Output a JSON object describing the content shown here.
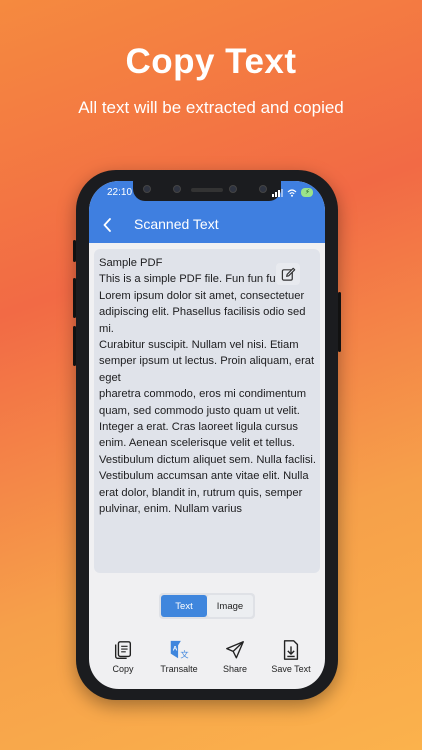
{
  "promo": {
    "title": "Copy Text",
    "subtitle": "All text will be extracted and copied"
  },
  "status_bar": {
    "time": "22:10"
  },
  "header": {
    "title": "Scanned Text"
  },
  "scanned_text": "Sample PDF\nThis is a simple PDF file. Fun fun fun.\nLorem ipsum dolor sit amet, consectetuer adipiscing elit. Phasellus facilisis odio sed mi.\nCurabitur suscipit. Nullam vel nisi. Etiam semper ipsum ut lectus. Proin aliquam, erat eget\npharetra commodo, eros mi condimentum quam, sed commodo justo quam ut velit.\nInteger a erat. Cras laoreet ligula cursus enim. Aenean scelerisque velit et tellus.\nVestibulum dictum aliquet sem. Nulla faclisi. Vestibulum accumsan ante vitae elit. Nulla\nerat dolor, blandit in, rutrum quis, semper pulvinar, enim. Nullam varius",
  "segment": {
    "options": [
      "Text",
      "Image"
    ],
    "selected": "Text"
  },
  "bottom_tabs": [
    {
      "label": "Copy",
      "icon": "copy-icon"
    },
    {
      "label": "Transalte",
      "icon": "translate-icon"
    },
    {
      "label": "Share",
      "icon": "share-icon"
    },
    {
      "label": "Save Text",
      "icon": "save-text-icon"
    }
  ],
  "colors": {
    "accent": "#3f7fe0",
    "translate_icon": "#3f86dd"
  }
}
